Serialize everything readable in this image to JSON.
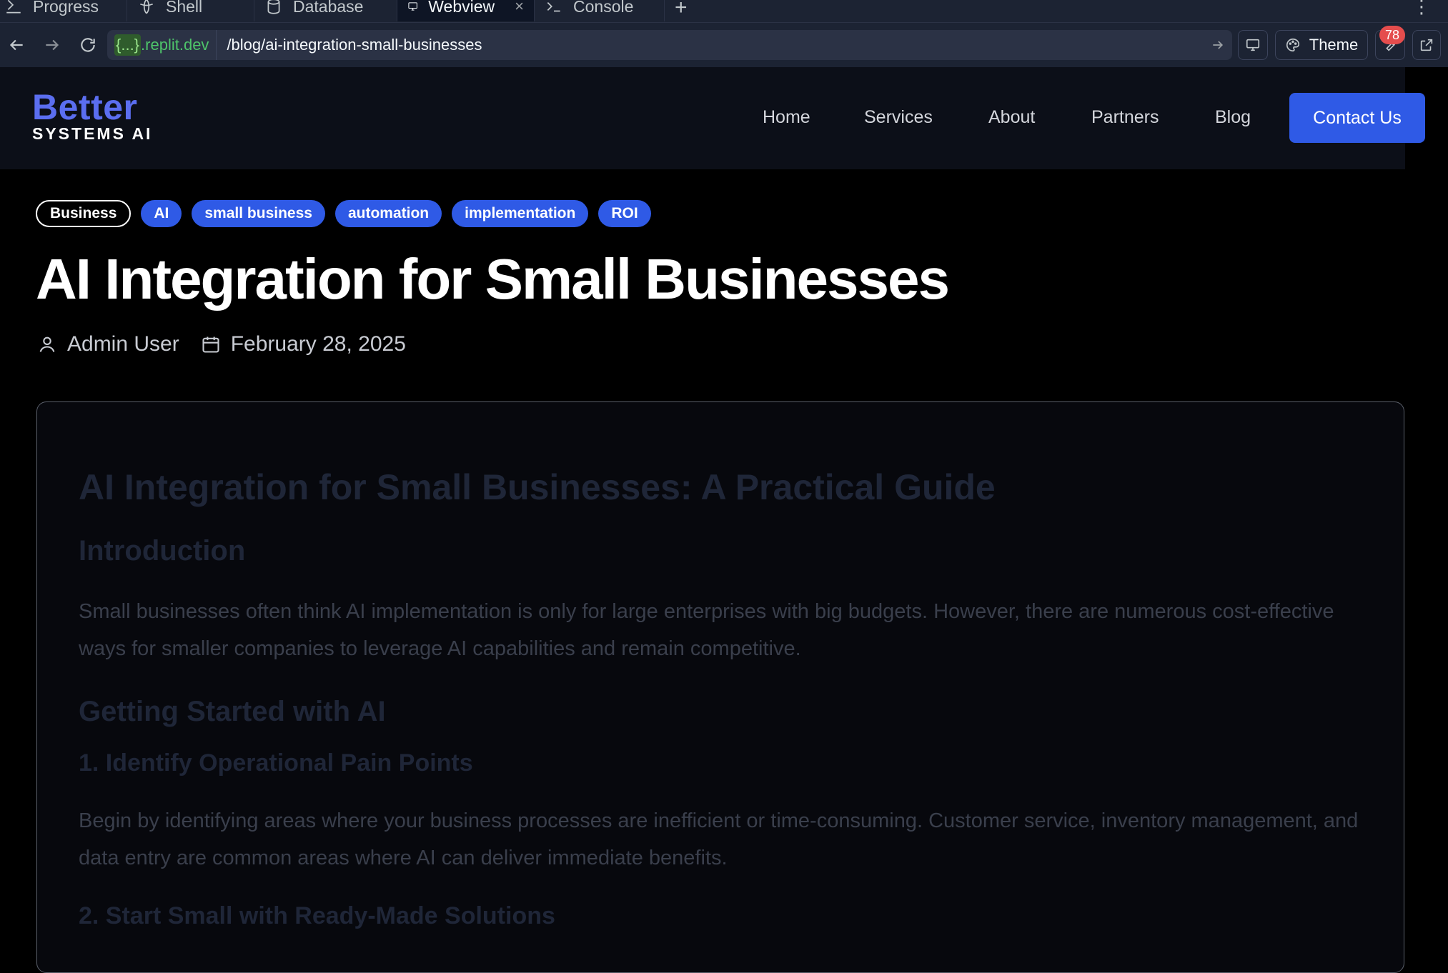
{
  "ide": {
    "tabs": [
      {
        "label": "Progress",
        "icon": "progress-icon"
      },
      {
        "label": "Shell",
        "icon": "shell-icon"
      },
      {
        "label": "Database",
        "icon": "database-icon"
      },
      {
        "label": "Webview",
        "icon": "monitor-icon",
        "active": true
      },
      {
        "label": "Console",
        "icon": "terminal-icon"
      }
    ],
    "tab_close": "×",
    "add_tab": "+",
    "more": "⋮"
  },
  "addressbar": {
    "host_prefix": "{...}",
    "host_suffix": ".replit.dev",
    "path": "/blog/ai-integration-small-businesses",
    "theme_label": "Theme",
    "badge_count": "78"
  },
  "site": {
    "logo_main": "Better",
    "logo_sub": "SYSTEMS AI",
    "nav": [
      "Home",
      "Services",
      "About",
      "Partners",
      "Blog"
    ],
    "cta": "Contact Us",
    "accent": "#2f5ae6"
  },
  "post": {
    "tags": [
      "Business",
      "AI",
      "small business",
      "automation",
      "implementation",
      "ROI"
    ],
    "title": "AI Integration for Small Businesses",
    "author": "Admin User",
    "date": "February 28, 2025"
  },
  "content": {
    "h1": "AI Integration for Small Businesses: A Practical Guide",
    "intro_heading": "Introduction",
    "intro_text": "Small businesses often think AI implementation is only for large enterprises with big budgets. However, there are numerous cost-effective ways for smaller companies to leverage AI capabilities and remain competitive.",
    "getting_started_heading": "Getting Started with AI",
    "step1_heading": "1. Identify Operational Pain Points",
    "step1_text": "Begin by identifying areas where your business processes are inefficient or time-consuming. Customer service, inventory management, and data entry are common areas where AI can deliver immediate benefits.",
    "step2_heading": "2. Start Small with Ready-Made Solutions"
  }
}
